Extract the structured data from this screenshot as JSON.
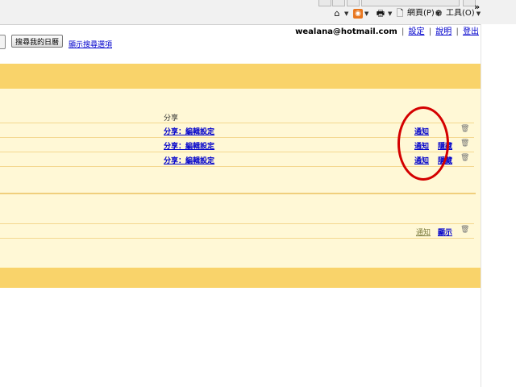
{
  "browser_toolbar": {
    "page_menu": "網頁(P)",
    "tools_menu": "工具(O)",
    "overflow": "»",
    "icons": [
      "home-icon",
      "rss-feed-icon",
      "print-icon",
      "page-icon",
      "gear-icon"
    ]
  },
  "account": {
    "email": "wealana@hotmail.com",
    "separator": "|",
    "settings": "設定",
    "help": "說明",
    "sign_out": "登出"
  },
  "search": {
    "button_label": "搜尋我的日曆",
    "show_options": "顯示搜尋選項"
  },
  "calendar_list": {
    "column_header": "分享",
    "rows": [
      {
        "share": "分享",
        "edit": "編輯設定",
        "notify": "通知",
        "hide": ""
      },
      {
        "share": "分享",
        "edit": "編輯設定",
        "notify": "通知",
        "hide": "隱藏"
      },
      {
        "share": "分享",
        "edit": "編輯設定",
        "notify": "通知",
        "hide": "隱藏"
      }
    ],
    "other_row": {
      "notify": "通知",
      "show": "顯示"
    }
  },
  "colors": {
    "band_yellow": "#f9d36a",
    "panel_yellow": "#fff8d6",
    "link_blue": "#0000cc",
    "annotation_red": "#d40000"
  }
}
